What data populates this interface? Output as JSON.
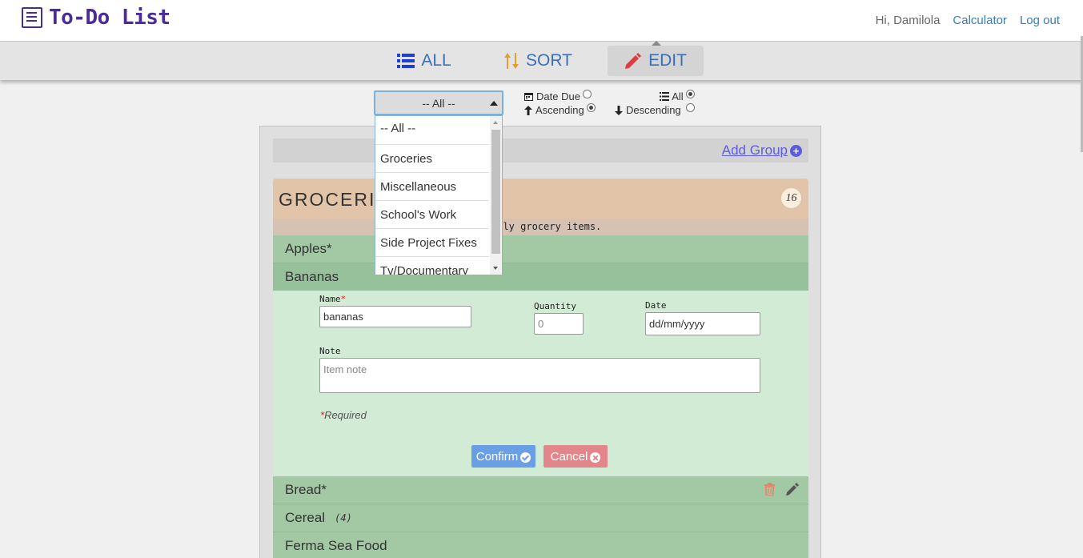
{
  "app": {
    "title": "To-Do List",
    "user_greeting": "Hi, Damilola",
    "nav_calculator": "Calculator",
    "nav_logout": "Log out"
  },
  "tabs": [
    {
      "label": "ALL",
      "icon": "list-icon"
    },
    {
      "label": "SORT",
      "icon": "sort-icon"
    },
    {
      "label": "EDIT",
      "icon": "pencil-icon",
      "active": true
    }
  ],
  "filter": {
    "selected_group": "-- All --",
    "options": [
      "-- All --",
      "Groceries",
      "Miscellaneous",
      "School's Work",
      "Side Project Fixes",
      "Tv/Documentary"
    ],
    "date_due_label": "Date Due",
    "ascending_label": "Ascending",
    "all_label": "All",
    "descending_label": "Descending",
    "date_due_checked": false,
    "ascending_checked": true,
    "all_checked": true,
    "descending_checked": false
  },
  "panel": {
    "add_group_label": "Add Group",
    "group": {
      "name": "GROCERI",
      "count": "16",
      "note": "ekly grocery items."
    },
    "items": [
      {
        "name": "Apples*"
      },
      {
        "name": "Bananas",
        "selected": true
      },
      {
        "name": "Bread*"
      },
      {
        "name": "Cereal",
        "count": "(4)"
      },
      {
        "name": "Ferma Sea Food"
      }
    ],
    "form": {
      "name_label": "Name",
      "name_value": "bananas",
      "quantity_label": "Quantity",
      "quantity_placeholder": "0",
      "date_label": "Date",
      "date_placeholder": "dd/mm/yyyy",
      "note_label": "Note",
      "note_placeholder": "Item note",
      "required_note": "Required",
      "asterisk": "*",
      "confirm_label": "Confirm",
      "cancel_label": "Cancel"
    }
  },
  "colors": {
    "brand": "#4b2a9b",
    "link": "#3a7cb8",
    "group_header": "#e2c5a8",
    "item_row": "#a3c9a4",
    "form_bg": "#d2ebd4",
    "confirm": "#6a9fe6",
    "cancel": "#e3868b",
    "delete_icon": "#e8816b"
  }
}
